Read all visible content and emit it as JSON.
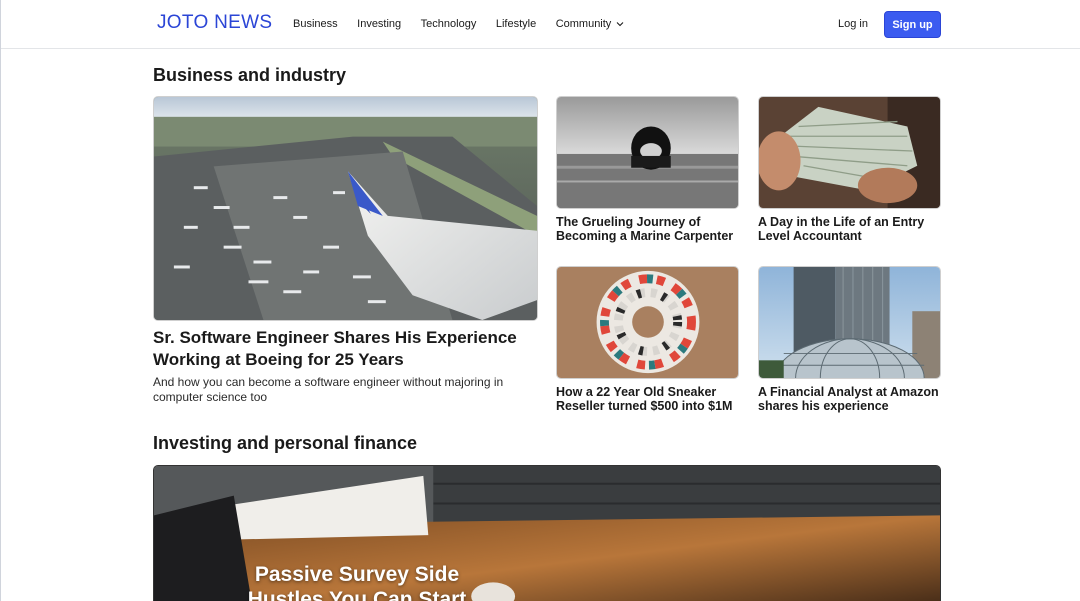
{
  "header": {
    "logo": "JOTO NEWS",
    "nav": [
      "Business",
      "Investing",
      "Technology",
      "Lifestyle",
      "Community"
    ],
    "login": "Log in",
    "signup": "Sign up"
  },
  "sections": {
    "business": {
      "title": "Business and industry",
      "hero": {
        "title": "Sr. Software Engineer Shares His Experience Working at Boeing for 25 Years",
        "subtitle": "And how you can become a software engineer without majoring in computer science too"
      },
      "cards": [
        "The Grueling Journey of Becoming a Marine Carpenter",
        "A Day in the Life of an Entry Level Accountant",
        "How a 22 Year Old Sneaker Reseller turned $500 into $1M",
        "A Financial Analyst at Amazon shares his experience"
      ]
    },
    "investing": {
      "title": "Investing and personal finance",
      "feature_title": "Passive Survey Side Hustles You Can Start"
    }
  },
  "colors": {
    "brand": "#2b45d6",
    "button": "#3b5bf0"
  }
}
